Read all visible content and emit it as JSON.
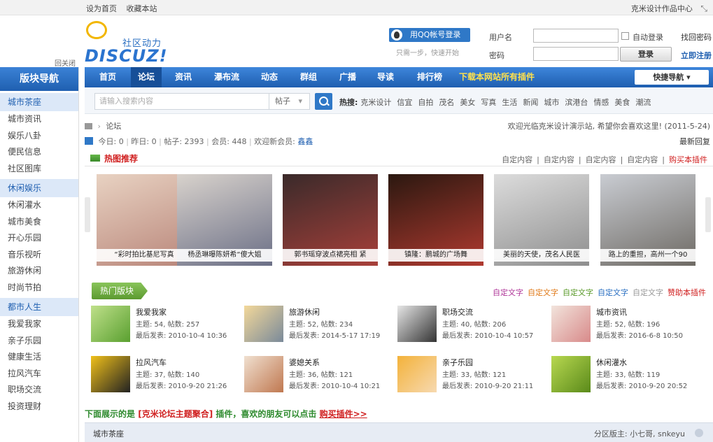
{
  "topbar": {
    "set_home": "设为首页",
    "bookmark": "收藏本站",
    "right_link": "克米设计作品中心"
  },
  "logo": {
    "tagline": "社区动力",
    "word_prefix": "DISCUZ",
    "word_suffix": "!",
    "close_link": "回关闭"
  },
  "login": {
    "qq_button": "用QQ帐号登录",
    "qq_tip": "只需一步，快速开始",
    "username_label": "用户名",
    "password_label": "密码",
    "auto_login": "自动登录",
    "forgot": "找回密码",
    "login_button": "登录",
    "register": "立即注册"
  },
  "sidebar": {
    "heading": "版块导航",
    "groups": [
      {
        "title": "城市茶座",
        "items": [
          "城市资讯",
          "娱乐八卦",
          "便民信息",
          "社区图库"
        ]
      },
      {
        "title": "休闲娱乐",
        "items": [
          "休闲灌水",
          "城市美食",
          "开心乐园",
          "音乐视听",
          "旅游休闲",
          "时尚节拍"
        ]
      },
      {
        "title": "都市人生",
        "items": [
          "我爱我家",
          "亲子乐园",
          "健康生活",
          "拉风汽车",
          "职场交流",
          "投资理财"
        ]
      }
    ]
  },
  "nav": {
    "items": [
      "首页",
      "论坛",
      "资讯",
      "瀑布流",
      "动态",
      "群组",
      "广播",
      "导读",
      "排行榜"
    ],
    "highlight": "下载本网站所有插件",
    "quick_nav": "快捷导航"
  },
  "search": {
    "placeholder": "请输入搜索内容",
    "scope": "帖子",
    "hot_label": "热搜:",
    "hot_terms": [
      "克米设计",
      "信宜",
      "自拍",
      "茂名",
      "美女",
      "写真",
      "生活",
      "新闻",
      "城市",
      "滨港台",
      "情感",
      "美食",
      "潮流"
    ]
  },
  "breadcrumb": {
    "current": "论坛"
  },
  "welcome": "欢迎光临克米设计演示站, 希望你会喜欢这里! (2011-5-24)",
  "stats": {
    "today": "今日: 0",
    "yesterday": "昨日: 0",
    "posts": "帖子: 2393",
    "members": "会员: 448",
    "newest_label": "欢迎新会员:",
    "newest": "鑫鑫",
    "latest_reply": "最新回复"
  },
  "hot_recommend": {
    "title": "热图推荐",
    "links": [
      "自定内容",
      "自定内容",
      "自定内容",
      "自定内容"
    ],
    "buy_link": "购买本插件"
  },
  "pictures": [
    {
      "caption": "“彩时拍比基尼写真",
      "colors": [
        "#e8d2c2",
        "#b9867a"
      ]
    },
    {
      "caption": "杨丞琳曝陈妍希“傻大姐",
      "colors": [
        "#d8d2cc",
        "#6b6f86"
      ]
    },
    {
      "caption": "郭书瑶穿波点裙亮相 紧",
      "colors": [
        "#3a2a2a",
        "#a8403a"
      ]
    },
    {
      "caption": "镇隆：鹏城的广场舞",
      "colors": [
        "#2b1810",
        "#b03a30"
      ]
    },
    {
      "caption": "美丽的天使，茂名人民医",
      "colors": [
        "#dcdcdc",
        "#8e8e8e"
      ]
    },
    {
      "caption": "路上的重担，高州一个90",
      "colors": [
        "#c9ccd2",
        "#6e6a64"
      ]
    }
  ],
  "hot_forums": {
    "title": "热门版块",
    "links": [
      {
        "text": "自定文字",
        "color": "#b0389a"
      },
      {
        "text": "自定文字",
        "color": "#e07a1a"
      },
      {
        "text": "自定文字",
        "color": "#5a9a2a"
      },
      {
        "text": "自定文字",
        "color": "#2a6fc2"
      },
      {
        "text": "自定文字",
        "color": "#999999"
      },
      {
        "text": "赞助本插件",
        "color": "#d02020"
      }
    ],
    "items": [
      {
        "name": "我爱我家",
        "stat": "主题: 54, 帖数: 257",
        "last": "最后发表: 2010-10-4 10:36",
        "colors": [
          "#bfe08a",
          "#5aa030"
        ]
      },
      {
        "name": "旅游休闲",
        "stat": "主题: 52, 帖数: 234",
        "last": "最后发表: 2014-5-17 17:19",
        "colors": [
          "#f3d89a",
          "#7a8a9a"
        ]
      },
      {
        "name": "职场交流",
        "stat": "主题: 40, 帖数: 206",
        "last": "最后发表: 2010-10-4 10:57",
        "colors": [
          "#e6e6e6",
          "#333333"
        ]
      },
      {
        "name": "城市资讯",
        "stat": "主题: 52, 帖数: 196",
        "last": "最后发表: 2016-6-8 10:50",
        "colors": [
          "#f2e4dc",
          "#d88a8a"
        ]
      },
      {
        "name": "拉风汽车",
        "stat": "主题: 37, 帖数: 140",
        "last": "最后发表: 2010-9-20 21:26",
        "colors": [
          "#f0c01a",
          "#222222"
        ]
      },
      {
        "name": "婆媳关系",
        "stat": "主题: 36, 帖数: 121",
        "last": "最后发表: 2010-10-4 10:21",
        "colors": [
          "#f0e0d0",
          "#c07850"
        ]
      },
      {
        "name": "亲子乐园",
        "stat": "主题: 33, 帖数: 121",
        "last": "最后发表: 2010-9-20 21:11",
        "colors": [
          "#f3b23a",
          "#f7d9b0"
        ]
      },
      {
        "name": "休闲灌水",
        "stat": "主题: 33, 帖数: 119",
        "last": "最后发表: 2010-9-20 20:52",
        "colors": [
          "#b8d850",
          "#5a8a1a"
        ]
      }
    ]
  },
  "promo": {
    "prefix": "下面展示的是",
    "plugin": "[克米论坛主题聚合]",
    "middle": "插件，喜欢的朋友可以点击",
    "link": "购买插件>>"
  },
  "zone": {
    "name": "城市茶座",
    "moderator_label": "分区版主:",
    "moderators": "小七哥, snkeyu"
  }
}
